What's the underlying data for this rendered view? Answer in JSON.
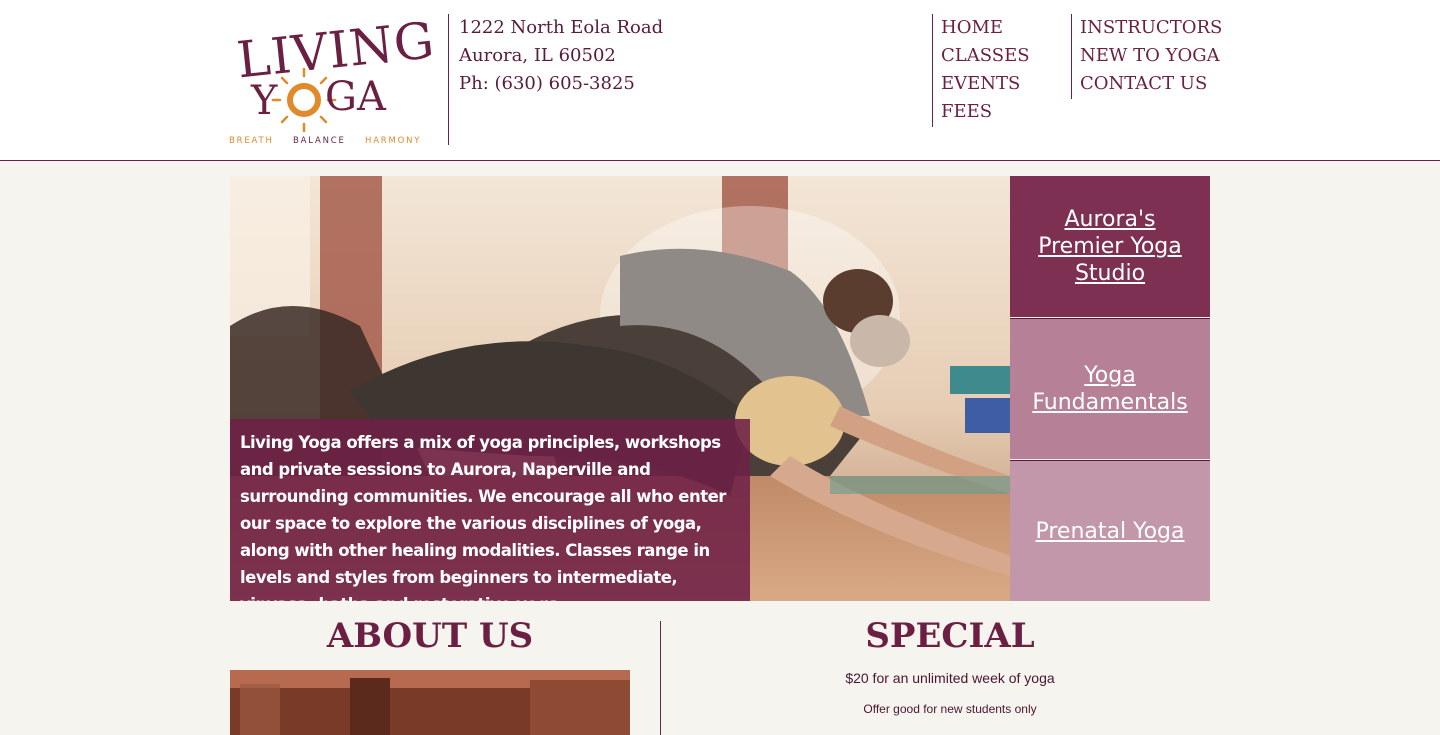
{
  "brand": {
    "logo_line1": "LIVING",
    "logo_line2": "YOGA",
    "tagline_breath": "BREATH",
    "tagline_balance": "BALANCE",
    "tagline_harmony": "HARMONY"
  },
  "address": {
    "street": "1222 North Eola Road",
    "city": "Aurora, IL 60502",
    "phone": "Ph: (630) 605-3825"
  },
  "nav": {
    "col1": [
      "HOME",
      "CLASSES",
      "EVENTS",
      "FEES"
    ],
    "col2": [
      "INSTRUCTORS",
      "NEW TO YOGA",
      "CONTACT US"
    ]
  },
  "hero": {
    "description": "Living Yoga offers a mix of yoga principles, workshops and private sessions to Aurora, Naperville and surrounding communities. We encourage all who enter our space to explore the various disciplines of yoga, along with other healing modalities. Classes range in levels and styles from beginners to intermediate, vinyasa, hatha and restorative yoga."
  },
  "promos": [
    {
      "label": "Aurora's Premier Yoga Studio"
    },
    {
      "label": "Yoga Fundamentals"
    },
    {
      "label": "Prenatal Yoga"
    }
  ],
  "about": {
    "heading": "ABOUT US"
  },
  "special": {
    "heading": "SPECIAL",
    "offer": "$20 for an unlimited week of yoga",
    "note": "Offer good for new students only"
  },
  "colors": {
    "brand_plum": "#6b1f43",
    "logo_orange": "#e08a2c",
    "promo_dark": "#7d3052",
    "promo_mid": "#b68197",
    "promo_light": "#c297a9"
  }
}
